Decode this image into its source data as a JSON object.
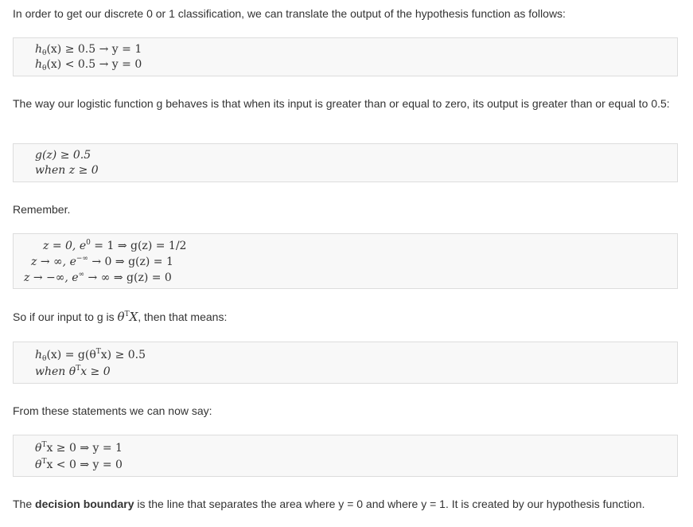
{
  "paragraphs": {
    "p1": "In order to get our discrete 0 or 1 classification, we can translate the output of the hypothesis function as follows:",
    "p2": "The way our logistic function g behaves is that when its input is greater than or equal to zero, its output is greater than or equal to 0.5:",
    "p3": "Remember.",
    "p4_pre": "So if our input to g is ",
    "p4_post": ", then that means:",
    "p5": "From these statements we can now say:",
    "p6_pre": "The ",
    "p6_bold": "decision boundary",
    "p6_post": " is the line that separates the area where y = 0 and where y = 1. It is created by our hypothesis function."
  },
  "math": {
    "b1_l1_rest": "(x) ≥ 0.5 → y = 1",
    "b1_l2_rest": "(x) < 0.5 → y = 0",
    "b2_l1": "g(z) ≥ 0.5",
    "b2_l2": "when z ≥ 0",
    "b3_l1": "z = 0, e",
    "b3_l1_exp": "0",
    "b3_l1_rest": " = 1 ⇒ g(z) = 1/2",
    "b3_l2": "z → ∞, e",
    "b3_l2_exp": "−∞",
    "b3_l2_rest": " → 0 ⇒ g(z) = 1",
    "b3_l3": "z → −∞, e",
    "b3_l3_exp": "∞",
    "b3_l3_rest": " → ∞ ⇒ g(z) = 0",
    "b4_l1_a": "(x) = g(θ",
    "b4_l1_b": "x) ≥ 0.5",
    "b4_l2_a": "when θ",
    "b4_l2_b": "x ≥ 0",
    "b5_l1": "x ≥ 0 ⇒ y = 1",
    "b5_l2": "x < 0 ⇒ y = 0",
    "h": "h",
    "theta": "θ",
    "T": "T",
    "X": "X"
  }
}
